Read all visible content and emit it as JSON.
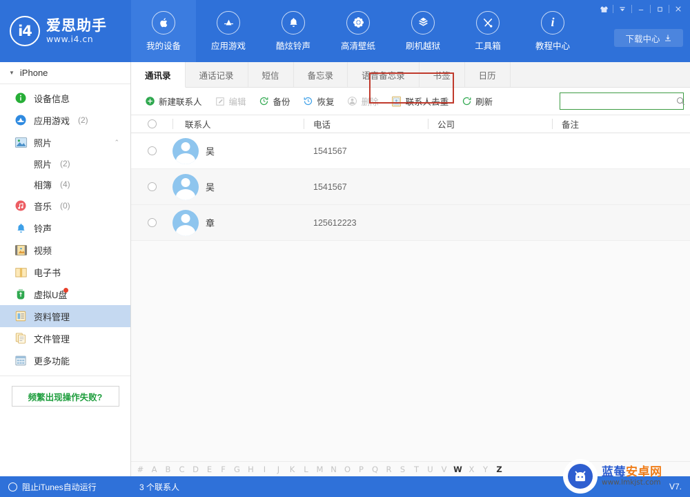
{
  "brand": {
    "name": "爱思助手",
    "url": "www.i4.cn",
    "logo_text": "i4"
  },
  "topnav": {
    "items": [
      {
        "label": "我的设备",
        "icon": "apple-icon",
        "active": true
      },
      {
        "label": "应用游戏",
        "icon": "appstore-icon",
        "active": false
      },
      {
        "label": "酷炫铃声",
        "icon": "bell-icon",
        "active": false
      },
      {
        "label": "高清壁纸",
        "icon": "flower-icon",
        "active": false
      },
      {
        "label": "刷机越狱",
        "icon": "openbox-icon",
        "active": false
      },
      {
        "label": "工具箱",
        "icon": "tools-icon",
        "active": false
      },
      {
        "label": "教程中心",
        "icon": "info-icon",
        "active": false
      }
    ],
    "download_center": "下载中心",
    "window_controls": [
      {
        "name": "skin-icon",
        "glyph": "T"
      },
      {
        "name": "menu-icon",
        "glyph": "▼"
      },
      {
        "name": "minimize-icon",
        "glyph": "—"
      },
      {
        "name": "maximize-icon",
        "glyph": "□"
      },
      {
        "name": "close-icon",
        "glyph": "✕"
      }
    ]
  },
  "sidebar": {
    "device": "iPhone",
    "items": [
      {
        "label": "设备信息",
        "count": "",
        "icon": "info-circle-icon",
        "selected": false,
        "sub": false,
        "chevron": "",
        "dot": false
      },
      {
        "label": "应用游戏",
        "count": "(2)",
        "icon": "appstore-circle-icon",
        "selected": false,
        "sub": false,
        "chevron": "",
        "dot": false
      },
      {
        "label": "照片",
        "count": "",
        "icon": "photo-icon",
        "selected": false,
        "sub": false,
        "chevron": "⌃",
        "dot": false
      },
      {
        "label": "照片",
        "count": "(2)",
        "icon": "",
        "selected": false,
        "sub": true,
        "chevron": "",
        "dot": false
      },
      {
        "label": "相簿",
        "count": "(4)",
        "icon": "",
        "selected": false,
        "sub": true,
        "chevron": "",
        "dot": false
      },
      {
        "label": "音乐",
        "count": "(0)",
        "icon": "music-icon",
        "selected": false,
        "sub": false,
        "chevron": "",
        "dot": false
      },
      {
        "label": "铃声",
        "count": "",
        "icon": "bell-icon",
        "selected": false,
        "sub": false,
        "chevron": "",
        "dot": false
      },
      {
        "label": "视频",
        "count": "",
        "icon": "film-icon",
        "selected": false,
        "sub": false,
        "chevron": "",
        "dot": false
      },
      {
        "label": "电子书",
        "count": "",
        "icon": "book-icon",
        "selected": false,
        "sub": false,
        "chevron": "",
        "dot": false
      },
      {
        "label": "虚拟U盘",
        "count": "",
        "icon": "usb-icon",
        "selected": false,
        "sub": false,
        "chevron": "",
        "dot": true
      },
      {
        "label": "资料管理",
        "count": "",
        "icon": "data-icon",
        "selected": true,
        "sub": false,
        "chevron": "",
        "dot": false
      },
      {
        "label": "文件管理",
        "count": "",
        "icon": "file-icon",
        "selected": false,
        "sub": false,
        "chevron": "",
        "dot": false
      },
      {
        "label": "更多功能",
        "count": "",
        "icon": "grid-icon",
        "selected": false,
        "sub": false,
        "chevron": "",
        "dot": false
      }
    ],
    "help_button": "频繁出现操作失败?",
    "itunes_toggle": "阻止iTunes自动运行"
  },
  "tabs": [
    {
      "label": "通讯录",
      "active": true
    },
    {
      "label": "通话记录",
      "active": false
    },
    {
      "label": "短信",
      "active": false
    },
    {
      "label": "备忘录",
      "active": false
    },
    {
      "label": "语音备忘录",
      "active": false
    },
    {
      "label": "书签",
      "active": false
    },
    {
      "label": "日历",
      "active": false
    }
  ],
  "toolbar": {
    "buttons": [
      {
        "label": "新建联系人",
        "icon": "plus-circle-icon",
        "disabled": false,
        "highlighted": false
      },
      {
        "label": "编辑",
        "icon": "edit-icon",
        "disabled": true,
        "highlighted": false
      },
      {
        "label": "备份",
        "icon": "backup-icon",
        "disabled": false,
        "highlighted": false
      },
      {
        "label": "恢复",
        "icon": "restore-icon",
        "disabled": false,
        "highlighted": false
      },
      {
        "label": "删除",
        "icon": "delete-icon",
        "disabled": true,
        "highlighted": false
      },
      {
        "label": "联系人去重",
        "icon": "dedupe-icon",
        "disabled": false,
        "highlighted": true
      },
      {
        "label": "刷新",
        "icon": "refresh-icon",
        "disabled": false,
        "highlighted": false
      }
    ],
    "highlight_color": "#c0392b"
  },
  "search": {
    "value": "",
    "placeholder": "",
    "icon": "search-icon",
    "border_color": "#3d9b43"
  },
  "table": {
    "columns": [
      "联系人",
      "电话",
      "公司",
      "备注"
    ],
    "rows": [
      {
        "name": "吴",
        "phone": "1541567",
        "company": "",
        "note": ""
      },
      {
        "name": "吴",
        "phone": "1541567",
        "company": "",
        "note": ""
      },
      {
        "name": "章",
        "phone": "125612223",
        "company": "",
        "note": ""
      }
    ]
  },
  "alpha_index": {
    "letters": [
      "#",
      "A",
      "B",
      "C",
      "D",
      "E",
      "F",
      "G",
      "H",
      "I",
      "J",
      "K",
      "L",
      "M",
      "N",
      "O",
      "P",
      "Q",
      "R",
      "S",
      "T",
      "U",
      "V",
      "W",
      "X",
      "Y",
      "Z"
    ],
    "active": [
      "W",
      "Z"
    ]
  },
  "statusbar": {
    "left": "3 个联系人",
    "right": "V7."
  },
  "watermark": {
    "title_blue": "蓝莓",
    "title_orange": "安卓网",
    "url": "www.lmkjst.com",
    "icon": "android-robot-icon"
  }
}
